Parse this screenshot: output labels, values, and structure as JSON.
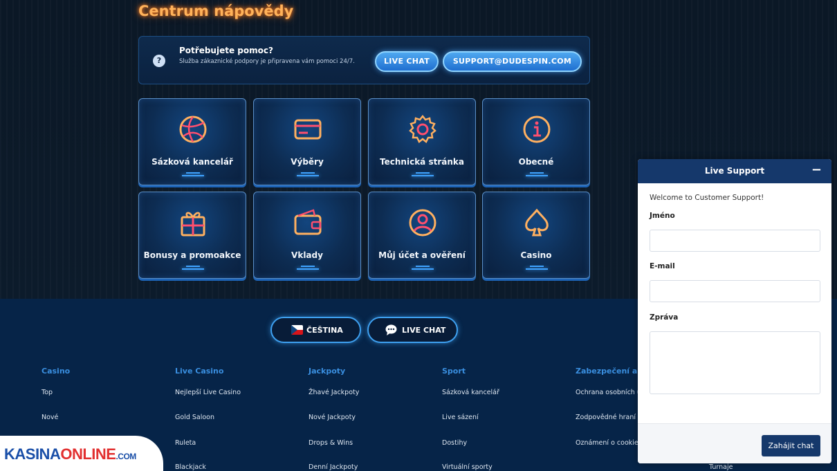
{
  "page_title": "Centrum nápovědy",
  "help_banner": {
    "icon": "question-icon",
    "title": "Potřebujete pomoc?",
    "description": "Služba zákaznické podpory je připravena vám pomoci 24/7.",
    "live_chat_label": "LIVE CHAT",
    "email_label": "SUPPORT@DUDESPIN.COM"
  },
  "categories": [
    {
      "label": "Sázková kancelář",
      "icon": "volleyball-icon"
    },
    {
      "label": "Výběry",
      "icon": "credit-card-icon"
    },
    {
      "label": "Technická stránka",
      "icon": "gear-icon"
    },
    {
      "label": "Obecné",
      "icon": "info-icon"
    },
    {
      "label": "Bonusy a promoakce",
      "icon": "gift-icon"
    },
    {
      "label": "Vklady",
      "icon": "wallet-icon"
    },
    {
      "label": "Můj účet a ověření",
      "icon": "user-icon"
    },
    {
      "label": "Casino",
      "icon": "spade-icon"
    }
  ],
  "footer": {
    "language_label": "ČEŠTINA",
    "live_chat_label": "LIVE CHAT",
    "columns": [
      {
        "heading": "Casino",
        "links": [
          "Top",
          "Nové"
        ]
      },
      {
        "heading": "Live Casino",
        "links": [
          "Nejlepší Live Casino",
          "Gold Saloon",
          "Ruleta",
          "Blackjack"
        ]
      },
      {
        "heading": "Jackpoty",
        "links": [
          "Žhavé Jackpoty",
          "Nové Jackpoty",
          "Drops & Wins",
          "Denní Jackpoty"
        ]
      },
      {
        "heading": "Sport",
        "links": [
          "Sázková kancelář",
          "Live sázení",
          "Dostihy",
          "Virtuální sporty"
        ]
      },
      {
        "heading": "Zabezpečení a s",
        "links": [
          "Ochrana osobních ú",
          "Zodpovědné hraní",
          "Oznámení o cookie"
        ]
      }
    ],
    "extra_link": "Turnaje"
  },
  "logo": {
    "part1": "KASINA",
    "part2": "ONLINE",
    "part3": ".COM"
  },
  "chat_widget": {
    "title": "Live Support",
    "minimize": "−",
    "welcome": "Welcome to Customer Support!",
    "name_label": "Jméno",
    "email_label": "E-mail",
    "message_label": "Zpráva",
    "start_button": "Zahájit chat"
  }
}
